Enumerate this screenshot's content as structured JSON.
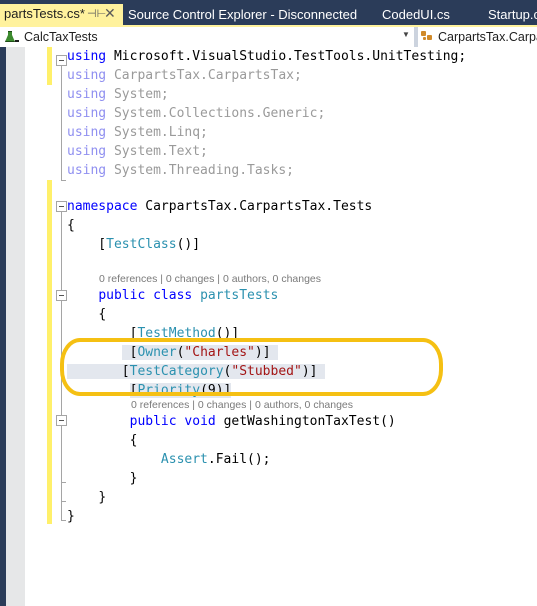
{
  "tabs": [
    {
      "label": "partsTests.cs*",
      "active": true,
      "pin_icon": "pin-icon",
      "close_icon": "close-icon"
    },
    {
      "label": "Source Control Explorer - Disconnected",
      "active": false
    },
    {
      "label": "CodedUI.cs",
      "active": false
    },
    {
      "label": "Startup.cs",
      "active": false
    }
  ],
  "navbar": {
    "project": "CalcTaxTests",
    "project_icon": "test-project-icon",
    "type_member": "CarpartsTax.Carpar",
    "type_icon": "class-icon"
  },
  "colors": {
    "accent_tab": "#fff29d",
    "frame": "#2b3c59",
    "keyword": "#0000ff",
    "type": "#2b91af",
    "string": "#a31515",
    "annotation_ring": "#f5c013"
  },
  "code": {
    "usings": [
      {
        "kw": "using",
        "ns": "Microsoft.VisualStudio.TestTools.UnitTesting;"
      },
      {
        "kw": "using",
        "ns": "CarpartsTax.CarpartsTax;"
      },
      {
        "kw": "using",
        "ns": "System;"
      },
      {
        "kw": "using",
        "ns": "System.Collections.Generic;"
      },
      {
        "kw": "using",
        "ns": "System.Linq;"
      },
      {
        "kw": "using",
        "ns": "System.Text;"
      },
      {
        "kw": "using",
        "ns": "System.Threading.Tasks;"
      }
    ],
    "namespace_kw": "namespace",
    "namespace_name": "CarpartsTax.CarpartsTax.Tests",
    "open_brace": "{",
    "close_brace": "}",
    "test_class_attr": "TestClass",
    "class_lens": "0 references | 0 changes | 0 authors, 0 changes",
    "class_decl": {
      "kw1": "public",
      "kw2": "class",
      "name": "partsTests"
    },
    "test_method_attr": "TestMethod",
    "owner_attr": "Owner",
    "owner_value": "\"Charles\"",
    "category_attr": "TestCategory",
    "category_value": "\"Stubbed\"",
    "priority_attr": "Priority",
    "priority_value": "9",
    "method_lens": "0 references | 0 changes | 0 authors, 0 changes",
    "method_decl": {
      "kw1": "public",
      "kw2": "void",
      "name": "getWashingtonTaxTest()"
    },
    "body_type": "Assert",
    "body_call": ".Fail();"
  }
}
